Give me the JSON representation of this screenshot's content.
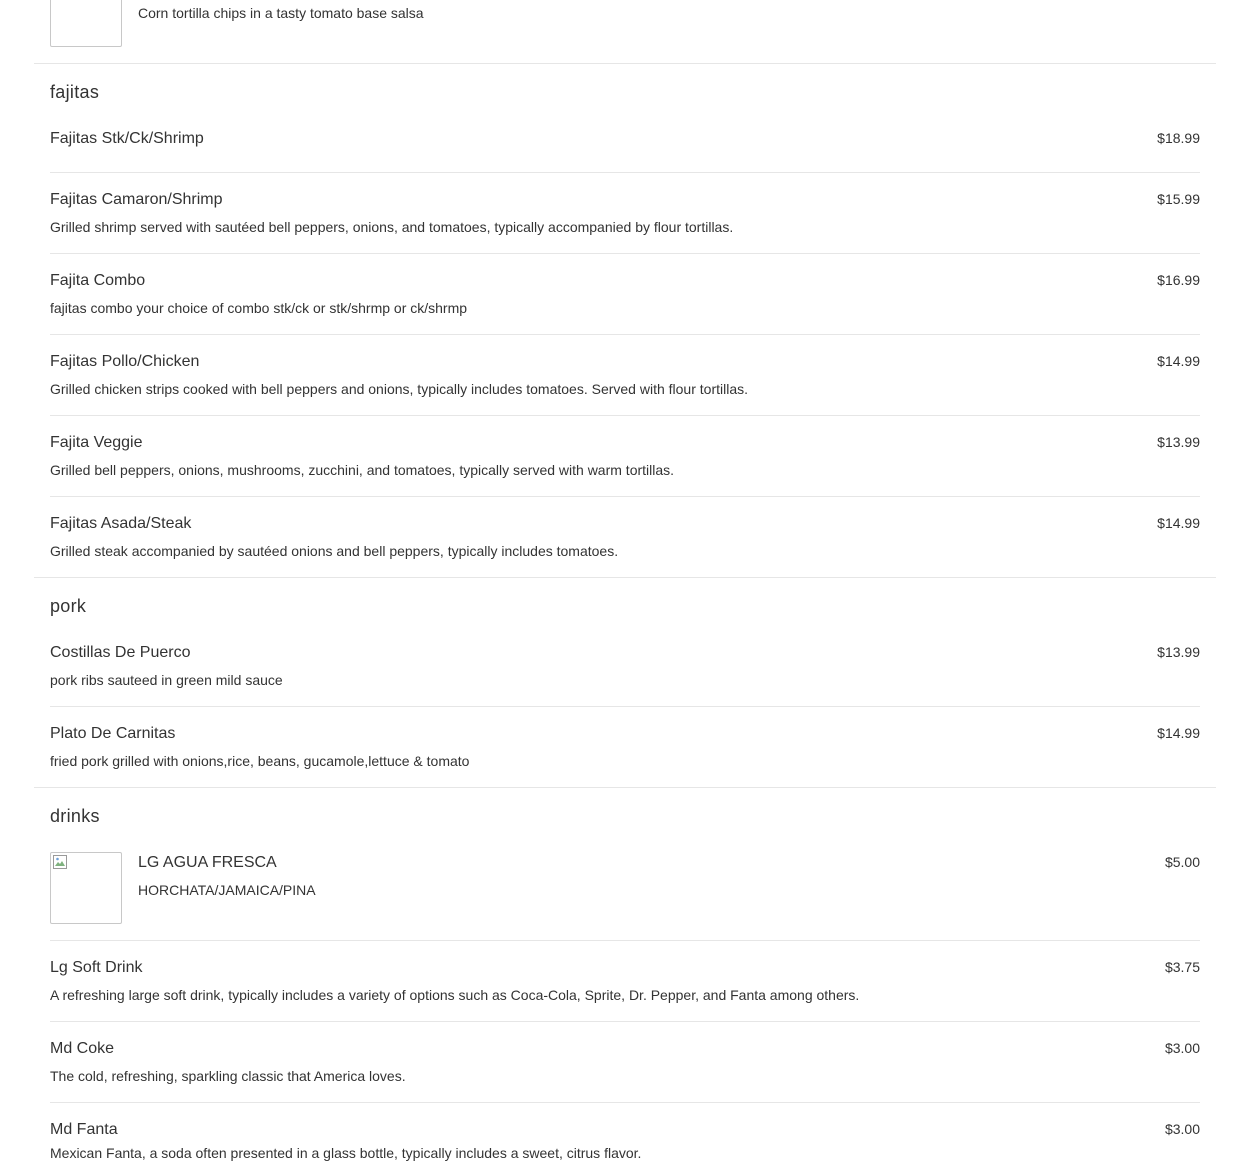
{
  "menu": {
    "salsa_partial": {
      "description": "Corn tortilla chips in a tasty tomato base salsa",
      "image_icon": "broken-image-icon"
    },
    "sections": {
      "fajitas": {
        "title": "fajitas",
        "items": [
          {
            "name": "Fajitas Stk/Ck/Shrimp",
            "price": "$18.99",
            "description": ""
          },
          {
            "name": "Fajitas Camaron/Shrimp",
            "price": "$15.99",
            "description": "Grilled shrimp served with sautéed bell peppers, onions, and tomatoes, typically accompanied by flour tortillas."
          },
          {
            "name": "Fajita Combo",
            "price": "$16.99",
            "description": "fajitas combo your choice of combo stk/ck or stk/shrmp or ck/shrmp"
          },
          {
            "name": "Fajitas Pollo/Chicken",
            "price": "$14.99",
            "description": "Grilled chicken strips cooked with bell peppers and onions, typically includes tomatoes. Served with flour tortillas."
          },
          {
            "name": "Fajita Veggie",
            "price": "$13.99",
            "description": "Grilled bell peppers, onions, mushrooms, zucchini, and tomatoes, typically served with warm tortillas."
          },
          {
            "name": "Fajitas Asada/Steak",
            "price": "$14.99",
            "description": "Grilled steak accompanied by sautéed onions and bell peppers, typically includes tomatoes."
          }
        ]
      },
      "pork": {
        "title": "pork",
        "items": [
          {
            "name": "Costillas De Puerco",
            "price": "$13.99",
            "description": "pork ribs sauteed in green mild sauce"
          },
          {
            "name": "Plato De Carnitas",
            "price": "$14.99",
            "description": "fried pork grilled with onions,rice, beans, gucamole,lettuce & tomato"
          }
        ]
      },
      "drinks": {
        "title": "drinks",
        "items": [
          {
            "name": "LG AGUA FRESCA",
            "price": "$5.00",
            "description": "HORCHATA/JAMAICA/PINA",
            "image_icon": "broken-image-icon"
          },
          {
            "name": "Lg Soft Drink",
            "price": "$3.75",
            "description": "A refreshing large soft drink, typically includes a variety of options such as Coca-Cola, Sprite, Dr. Pepper, and Fanta among others."
          },
          {
            "name": "Md Coke",
            "price": "$3.00",
            "description": "The cold, refreshing, sparkling classic that America loves."
          },
          {
            "name": "Md Fanta",
            "price": "$3.00",
            "description": "Mexican Fanta, a soda often presented in a glass bottle, typically includes a sweet, citrus flavor."
          }
        ]
      }
    }
  },
  "colors": {
    "text": "#333333",
    "divider": "#e6e6e6",
    "image_border": "#c8c8c8"
  }
}
